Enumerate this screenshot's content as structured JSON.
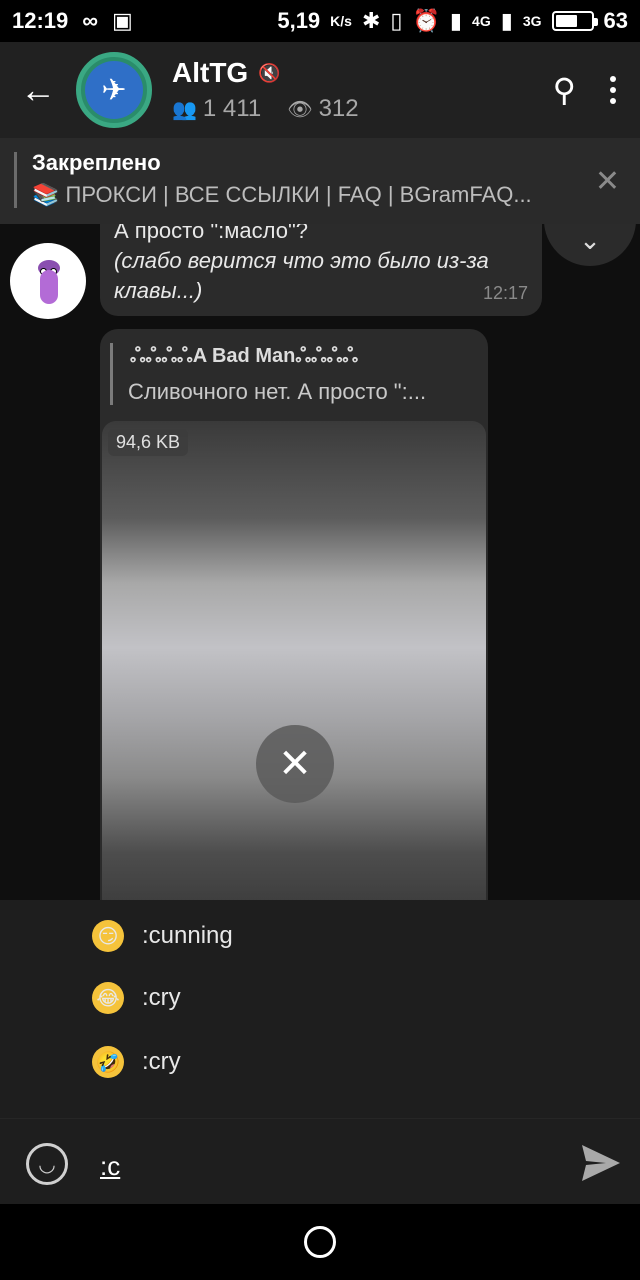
{
  "status_bar": {
    "time": "12:19",
    "speed": "5,19",
    "speed_unit": "K/s",
    "net1": "4G",
    "net2": "3G",
    "battery": "63",
    "battery_level": 0.63
  },
  "header": {
    "title": "AltTG",
    "members": "1 411",
    "views": "312"
  },
  "pinned": {
    "title": "Закреплено",
    "text": "📚 ПРОКСИ | ВСЕ ССЫЛКИ | FAQ | BGramFAQ..."
  },
  "messages": [
    {
      "line1": "А просто \":масло\"?",
      "line2": "(слабо верится что  это было из-за",
      "line3": "клавы...)",
      "time": "12:17"
    },
    {
      "reply_name": "ஃஃஃஃA Bad Manஃஃஃஃ",
      "reply_text": "Сливочного нет. А просто \":...",
      "file_size": "94,6 KB"
    }
  ],
  "suggestions": [
    {
      "emoji": "😏",
      "label": ":cunning"
    },
    {
      "emoji": "😂",
      "label": ":cry"
    },
    {
      "emoji": "🤣",
      "label": ":cry"
    }
  ],
  "input": {
    "text": ":c"
  }
}
